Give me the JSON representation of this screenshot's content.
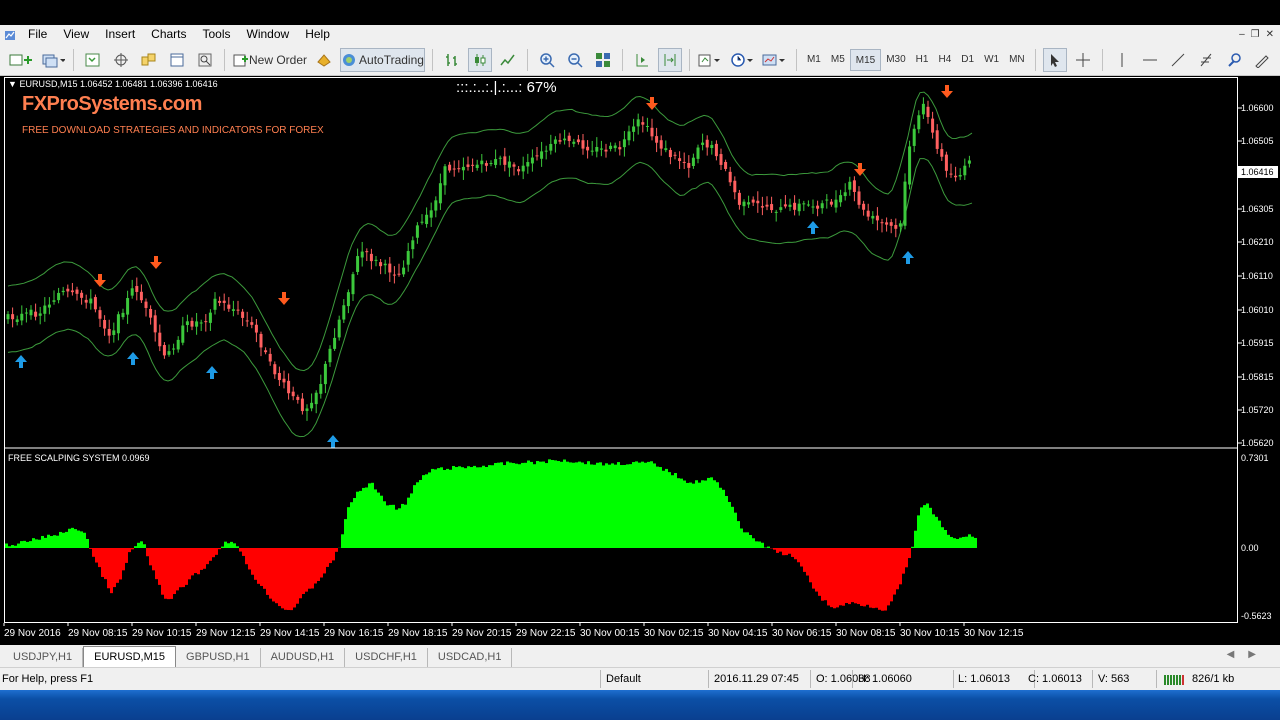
{
  "menu": {
    "items": [
      "File",
      "View",
      "Insert",
      "Charts",
      "Tools",
      "Window",
      "Help"
    ]
  },
  "toolbar": {
    "new_order": "New Order",
    "autotrading": "AutoTrading",
    "timeframes": [
      "M1",
      "M5",
      "M15",
      "M30",
      "H1",
      "H4",
      "D1",
      "W1",
      "MN"
    ],
    "active_timeframe": "M15"
  },
  "chart": {
    "symbol_info": "EURUSD,M15  1.06452 1.06481 1.06396 1.06416",
    "brand": "FXProSystems.com",
    "tagline": "FREE DOWNLOAD STRATEGIES AND INDICATORS FOR FOREX",
    "progress_text": ":::.:..:.|.:...:   67%",
    "price_labels": [
      "1.06600",
      "1.06505",
      "1.06416",
      "1.06305",
      "1.06210",
      "1.06110",
      "1.06010",
      "1.05915",
      "1.05815",
      "1.05720",
      "1.05620"
    ],
    "current_price": "1.06416",
    "indicator_title": "FREE SCALPING SYSTEM 0.0969",
    "indicator_labels": [
      "0.7301",
      "0.00",
      "-0.5623"
    ],
    "time_labels": [
      "29 Nov 2016",
      "29 Nov 08:15",
      "29 Nov 10:15",
      "29 Nov 12:15",
      "29 Nov 14:15",
      "29 Nov 16:15",
      "29 Nov 18:15",
      "29 Nov 20:15",
      "29 Nov 22:15",
      "30 Nov 00:15",
      "30 Nov 02:15",
      "30 Nov 04:15",
      "30 Nov 06:15",
      "30 Nov 08:15",
      "30 Nov 10:15",
      "30 Nov 12:15"
    ],
    "colors": {
      "bull": "#3cc83c",
      "bear": "#ff6060",
      "band": "#3c9a3c",
      "down_arrow": "#ff5a1e",
      "up_arrow": "#1e9be6",
      "hist_pos": "#00ff00",
      "hist_neg": "#ff0000"
    }
  },
  "tabs": {
    "items": [
      "USDJPY,H1",
      "EURUSD,M15",
      "GBPUSD,H1",
      "AUDUSD,H1",
      "USDCHF,H1",
      "USDCAD,H1"
    ],
    "active": "EURUSD,M15"
  },
  "status": {
    "help": "For Help, press F1",
    "profile": "Default",
    "datetime": "2016.11.29 07:45",
    "open": "O: 1.06038",
    "high": "H: 1.06060",
    "low": "L: 1.06013",
    "close": "C: 1.06013",
    "volume": "V: 563",
    "traffic": "826/1 kb"
  }
}
